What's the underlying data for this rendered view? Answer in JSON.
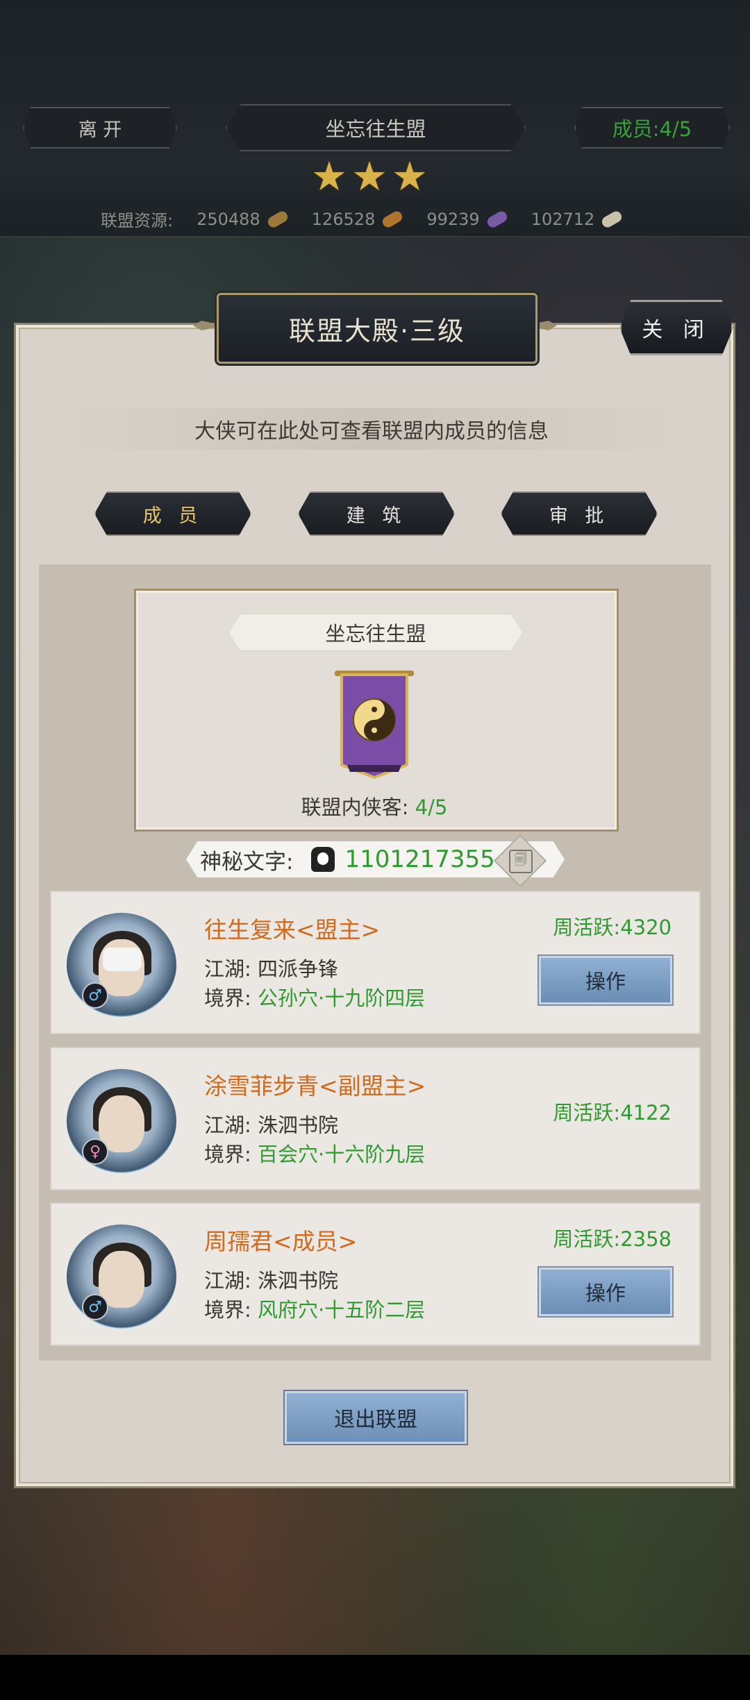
{
  "header": {
    "leave_label": "离 开",
    "alliance_name": "坐忘往生盟",
    "members_label": "成员:4/5",
    "stars": 3,
    "resources_label": "联盟资源:",
    "resources": [
      {
        "value": "250488",
        "icon": "wood-resource-icon",
        "color": "#9b7a3a"
      },
      {
        "value": "126528",
        "icon": "food-resource-icon",
        "color": "#b0742c"
      },
      {
        "value": "99239",
        "icon": "crystal-resource-icon",
        "color": "#7a5aa8"
      },
      {
        "value": "102712",
        "icon": "stone-resource-icon",
        "color": "#c8c2a8"
      }
    ]
  },
  "panel": {
    "title": "联盟大殿·三级",
    "close_label": "关 闭",
    "subtitle": "大侠可在此处可查看联盟内成员的信息",
    "tabs": [
      "成 员",
      "建 筑",
      "审 批"
    ],
    "active_tab": 0
  },
  "alliance_card": {
    "name": "坐忘往生盟",
    "flag_icon": "yin-yang-banner-icon",
    "flag_color": "#7b4da6",
    "members_label": "联盟内侠客:",
    "members_value": "4/5"
  },
  "code": {
    "label": "神秘文字:",
    "value": "1101217355",
    "copy_label": "🗐"
  },
  "members": [
    {
      "name": "往生复来<盟主>",
      "gender": "♂",
      "jianghu_label": "江湖:",
      "jianghu": "四派争锋",
      "realm_label": "境界:",
      "realm": "公孙穴·十九阶四层",
      "activity": "周活跃:4320",
      "button": "操作"
    },
    {
      "name": "涂雪菲步青<副盟主>",
      "gender": "♀",
      "jianghu_label": "江湖:",
      "jianghu": "洙泗书院",
      "realm_label": "境界:",
      "realm": "百会穴·十六阶九层",
      "activity": "周活跃:4122",
      "button": ""
    },
    {
      "name": "周孺君<成员>",
      "gender": "♂",
      "jianghu_label": "江湖:",
      "jianghu": "洙泗书院",
      "realm_label": "境界:",
      "realm": "风府穴·十五阶二层",
      "activity": "周活跃:2358",
      "button": "操作"
    }
  ],
  "footer": {
    "quit_label": "退出联盟"
  }
}
